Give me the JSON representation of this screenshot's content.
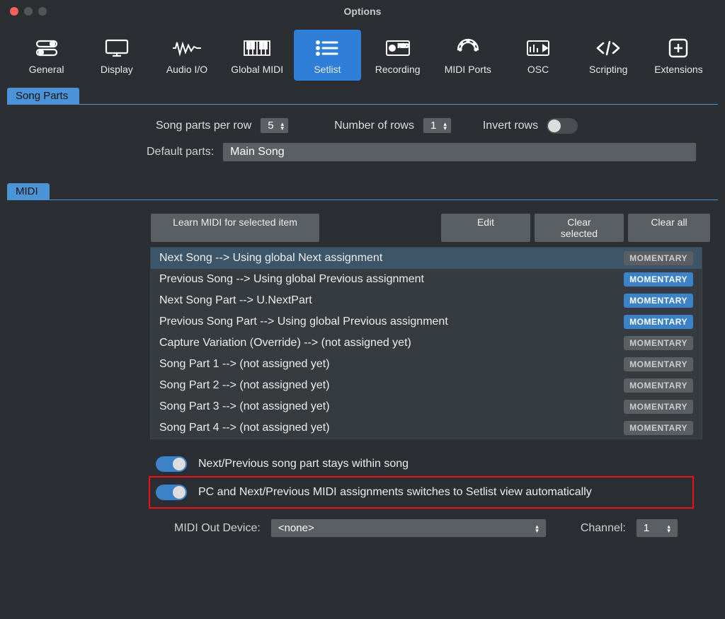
{
  "window": {
    "title": "Options"
  },
  "toolbar": {
    "items": [
      {
        "label": "General"
      },
      {
        "label": "Display"
      },
      {
        "label": "Audio I/O"
      },
      {
        "label": "Global MIDI"
      },
      {
        "label": "Setlist",
        "active": true
      },
      {
        "label": "Recording"
      },
      {
        "label": "MIDI Ports"
      },
      {
        "label": "OSC"
      },
      {
        "label": "Scripting"
      },
      {
        "label": "Extensions"
      }
    ]
  },
  "song_parts": {
    "section_label": "Song Parts",
    "per_row_label": "Song parts per row",
    "per_row_value": "5",
    "num_rows_label": "Number of rows",
    "num_rows_value": "1",
    "invert_label": "Invert rows",
    "invert_on": false,
    "default_parts_label": "Default parts:",
    "default_parts_value": "Main Song"
  },
  "midi": {
    "section_label": "MIDI",
    "buttons": {
      "learn": "Learn MIDI for selected item",
      "edit": "Edit",
      "clear_selected": "Clear selected",
      "clear_all": "Clear all"
    },
    "list": [
      {
        "text": "Next Song --> Using global Next assignment",
        "badge": "MOMENTARY",
        "badge_on": false,
        "selected": true
      },
      {
        "text": "Previous Song --> Using global Previous assignment",
        "badge": "MOMENTARY",
        "badge_on": true
      },
      {
        "text": "Next Song Part --> U.NextPart",
        "badge": "MOMENTARY",
        "badge_on": true
      },
      {
        "text": "Previous Song Part --> Using global Previous assignment",
        "badge": "MOMENTARY",
        "badge_on": true
      },
      {
        "text": "Capture Variation (Override) --> (not assigned yet)",
        "badge": "MOMENTARY",
        "badge_on": false
      },
      {
        "text": "Song Part 1 --> (not assigned yet)",
        "badge": "MOMENTARY",
        "badge_on": false
      },
      {
        "text": "Song Part 2 --> (not assigned yet)",
        "badge": "MOMENTARY",
        "badge_on": false
      },
      {
        "text": "Song Part 3 --> (not assigned yet)",
        "badge": "MOMENTARY",
        "badge_on": false
      },
      {
        "text": "Song Part 4 --> (not assigned yet)",
        "badge": "MOMENTARY",
        "badge_on": false
      }
    ],
    "toggle1_label": "Next/Previous song part stays within song",
    "toggle1_on": true,
    "toggle2_label": "PC and Next/Previous MIDI assignments switches to Setlist view automatically",
    "toggle2_on": true,
    "out_device_label": "MIDI Out Device:",
    "out_device_value": "<none>",
    "channel_label": "Channel:",
    "channel_value": "1"
  }
}
